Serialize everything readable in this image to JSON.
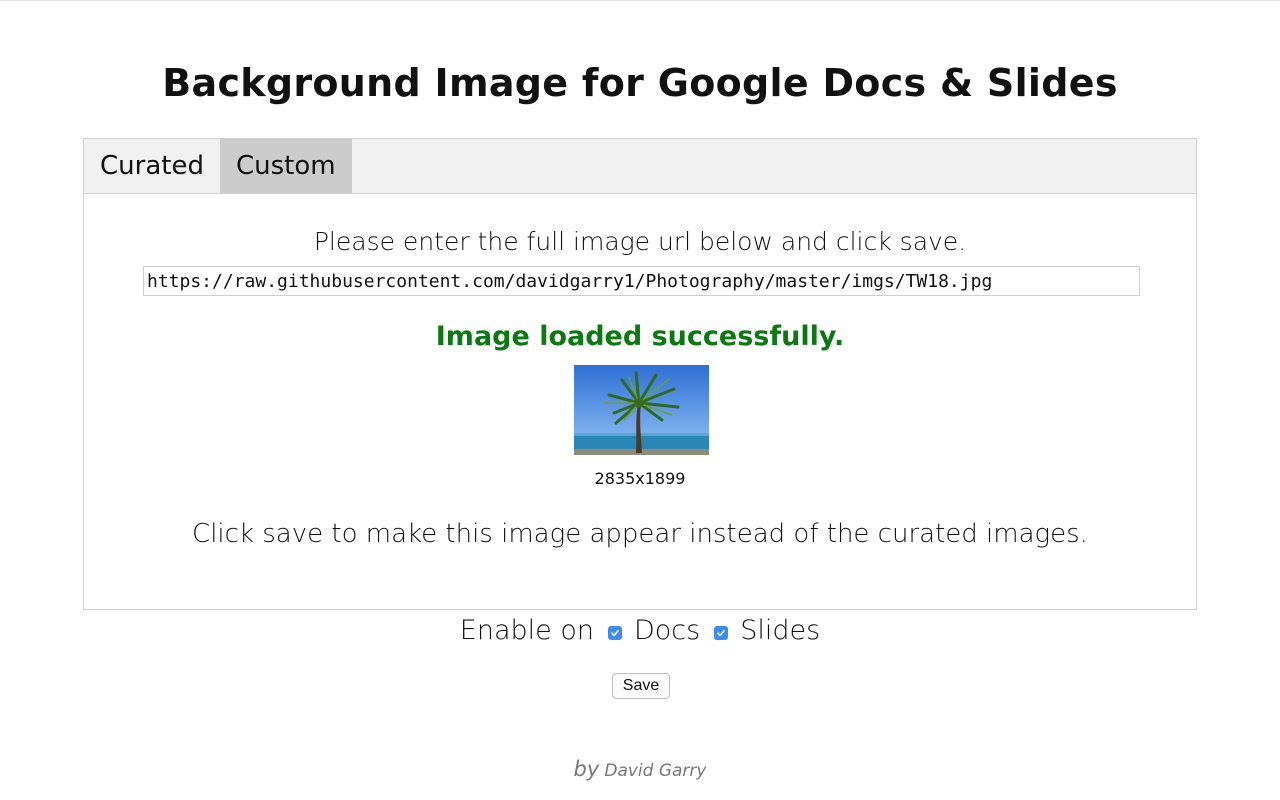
{
  "header": {
    "title": "Background Image for Google Docs & Slides"
  },
  "tabs": [
    {
      "label": "Curated",
      "active": false
    },
    {
      "label": "Custom",
      "active": true
    }
  ],
  "custom": {
    "instruction": "Please enter the full image url below and click save.",
    "url_value": "https://raw.githubusercontent.com/davidgarry1/Photography/master/imgs/TW18.jpg",
    "status": "Image loaded successfully.",
    "status_color": "#0a7a10",
    "preview_icon": "palm-tree-photo",
    "dimensions": "2835x1899",
    "note": "Click save to make this image appear instead of the curated images."
  },
  "enable": {
    "label": "Enable on",
    "options": [
      {
        "label": "Docs",
        "checked": true
      },
      {
        "label": "Slides",
        "checked": true
      }
    ],
    "checkbox_color": "#3b8df0"
  },
  "actions": {
    "save_label": "Save"
  },
  "footer": {
    "by": "by",
    "author": "David Garry"
  }
}
